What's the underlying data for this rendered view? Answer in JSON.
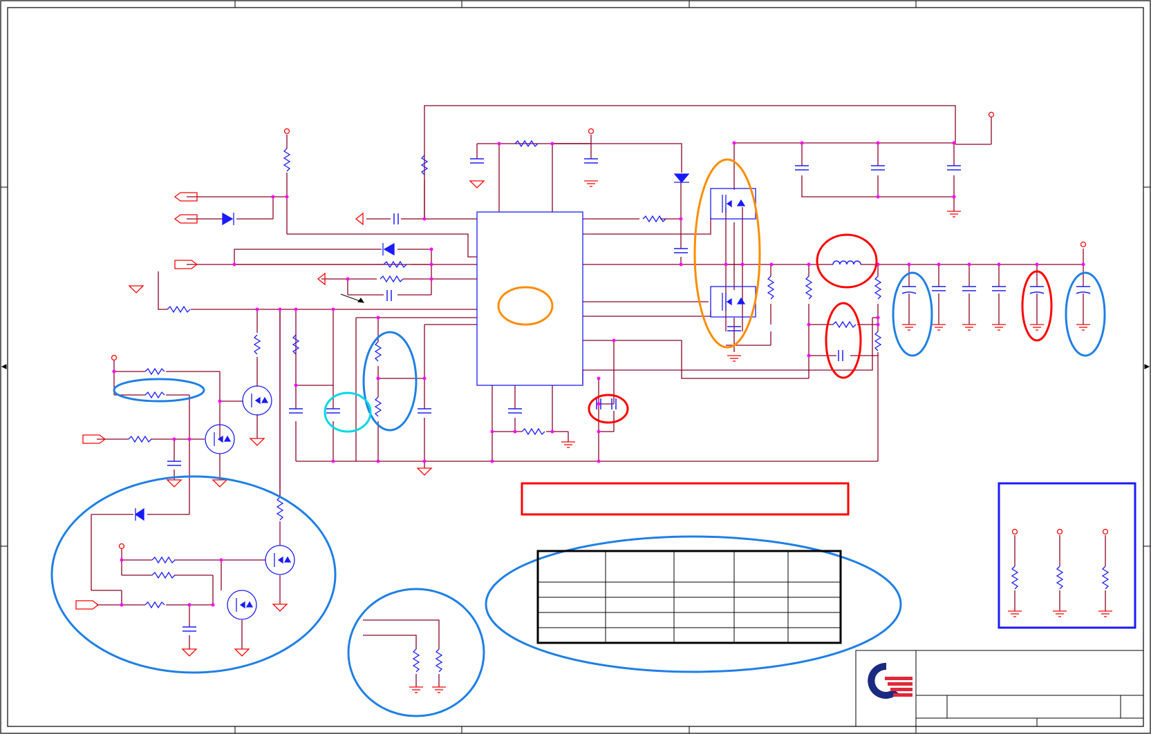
{
  "sheet": {
    "border_color": "#000000",
    "wire_color": "#8b0026",
    "component_color": "#1a1aff",
    "power_symbol_color": "#ff0000",
    "junction_color": "#ff00ff",
    "highlight_blue": "#1e7fe6",
    "highlight_red": "#ff0000",
    "highlight_orange": "#ff8c00",
    "highlight_cyan": "#00d8e6",
    "title_block_logo": "company-logo-icon",
    "text": []
  },
  "table": {
    "rows": 5,
    "columns": 5,
    "cells": []
  }
}
